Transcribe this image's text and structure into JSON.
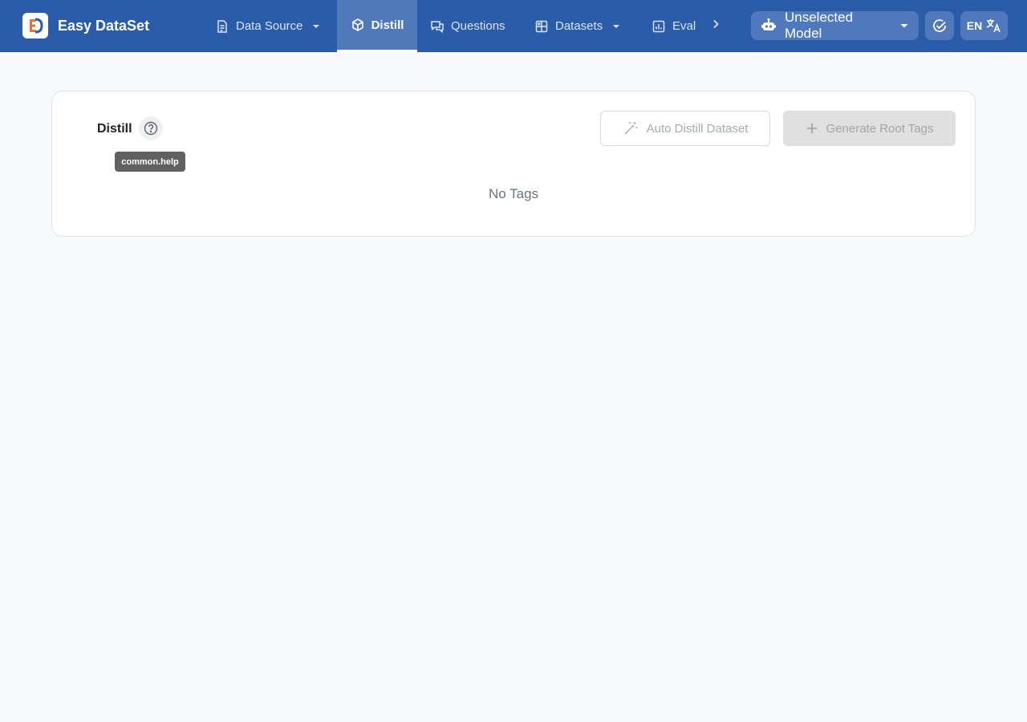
{
  "app": {
    "name": "Easy DataSet"
  },
  "nav": {
    "tabs": [
      {
        "label": "Data Source",
        "icon": "document-icon",
        "has_dropdown": true,
        "active": false
      },
      {
        "label": "Distill",
        "icon": "cube-icon",
        "has_dropdown": false,
        "active": true
      },
      {
        "label": "Questions",
        "icon": "chat-icon",
        "has_dropdown": false,
        "active": false
      },
      {
        "label": "Datasets",
        "icon": "grid-icon",
        "has_dropdown": true,
        "active": false
      },
      {
        "label": "Eval",
        "icon": "bar-chart-icon",
        "has_dropdown": false,
        "active": false
      }
    ]
  },
  "header": {
    "model_label": "Unselected Model",
    "language": "EN"
  },
  "main": {
    "title": "Distill",
    "help_tooltip": "common.help",
    "auto_distill_label": "Auto Distill Dataset",
    "generate_root_label": "Generate Root Tags",
    "empty_text": "No Tags"
  },
  "colors": {
    "topbar": "#2a5caa",
    "page_bg": "#f6f8fa"
  }
}
